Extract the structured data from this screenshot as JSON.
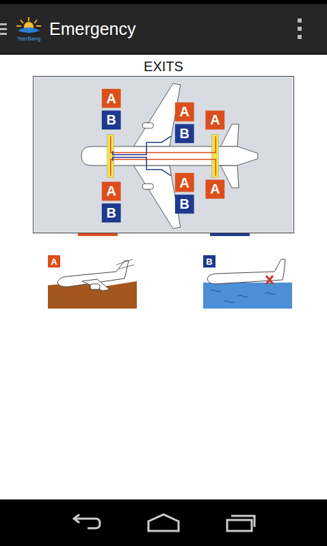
{
  "app_bar": {
    "title": "Emergency",
    "logo_text": "TeerBang"
  },
  "diagram": {
    "title": "EXITS",
    "legend": [
      {
        "key": "A",
        "color": "#dc4f1c"
      },
      {
        "key": "B",
        "color": "#1e3a8f"
      }
    ],
    "exits": [
      {
        "labels": [
          "A",
          "B"
        ]
      },
      {
        "labels": [
          "A",
          "B"
        ]
      },
      {
        "labels": [
          "A",
          "B"
        ]
      },
      {
        "labels": [
          "A",
          "B"
        ]
      },
      {
        "labels": [
          "A"
        ]
      },
      {
        "labels": [
          "A"
        ]
      }
    ]
  },
  "scenarios": [
    {
      "label": "A",
      "kind": "land",
      "color": "#dc4f1c"
    },
    {
      "label": "B",
      "kind": "water",
      "color": "#1e3a8f"
    }
  ]
}
